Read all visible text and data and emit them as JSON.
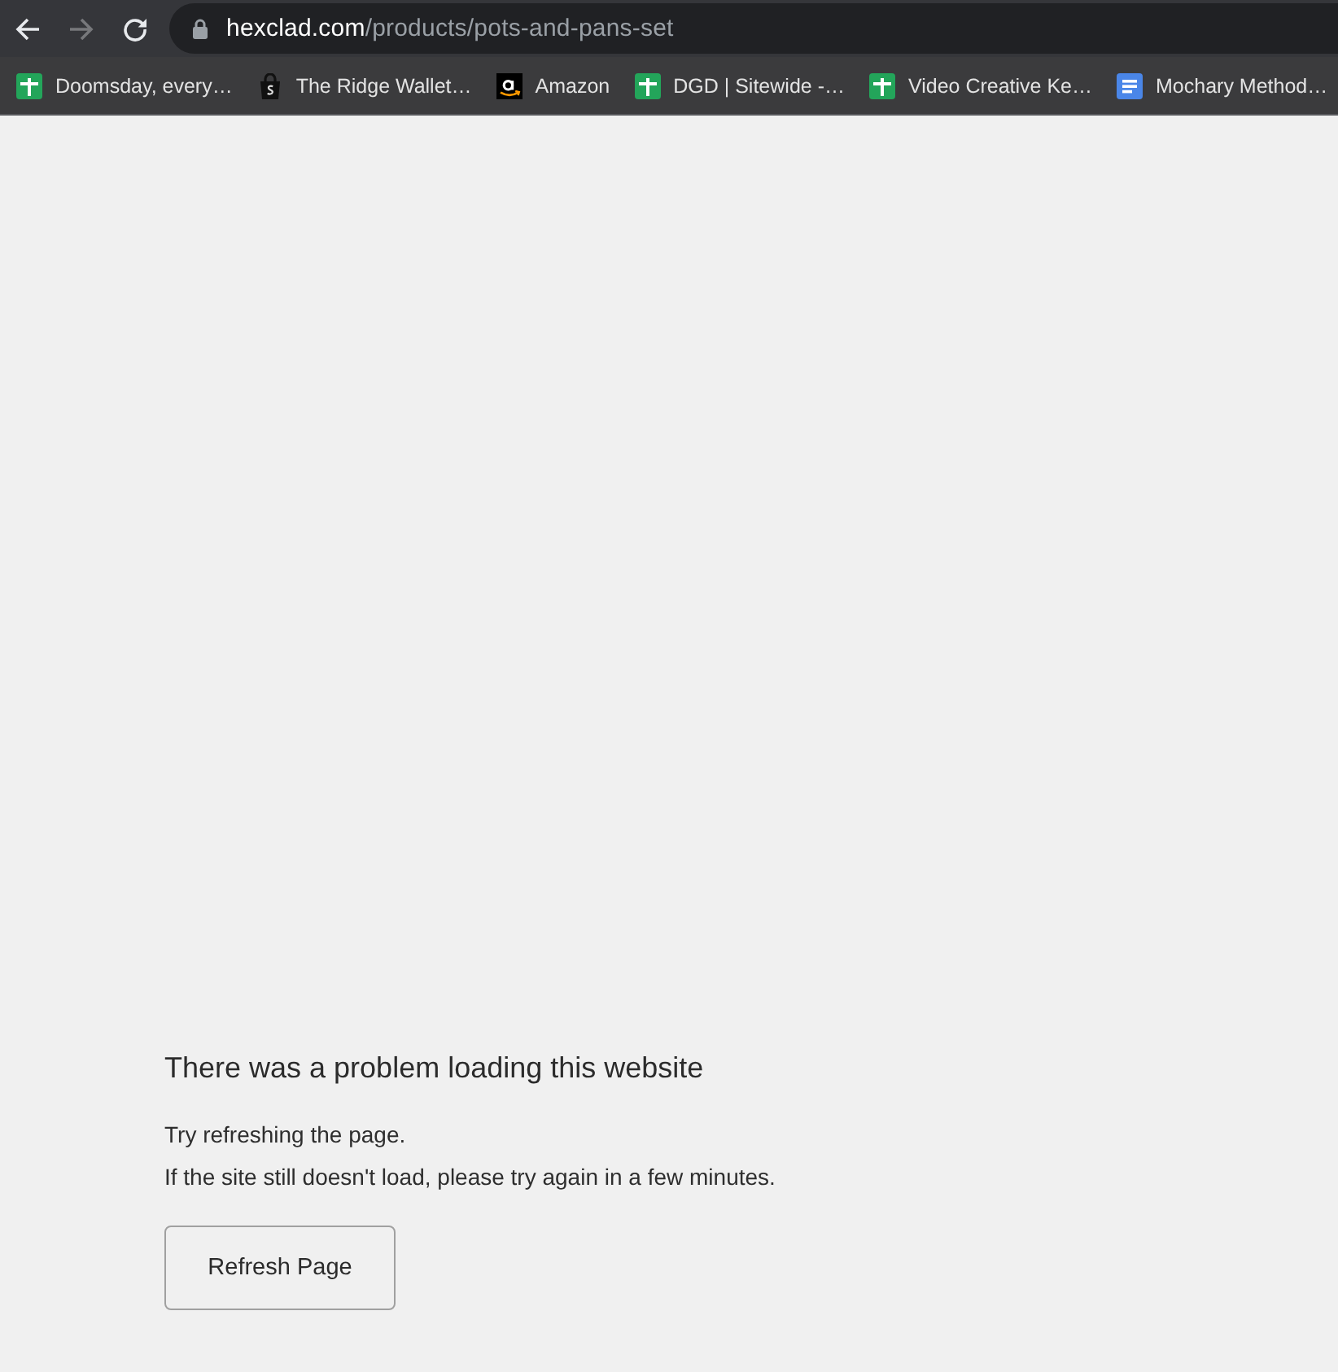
{
  "toolbar": {
    "nav_buttons": [
      {
        "kind": "back",
        "disabled": false
      },
      {
        "kind": "forward",
        "disabled": true
      },
      {
        "kind": "reload",
        "disabled": false
      }
    ],
    "address": {
      "host": "hexclad.com",
      "path": "/products/pots-and-pans-set"
    }
  },
  "bookmarks": [
    {
      "kind": "sheet",
      "label": "Doomsday, every…"
    },
    {
      "kind": "bag",
      "label": "The Ridge Wallet…"
    },
    {
      "kind": "smile",
      "label": "Amazon"
    },
    {
      "kind": "sheet",
      "label": "DGD | Sitewide -…"
    },
    {
      "kind": "sheet",
      "label": "Video Creative Ke…"
    },
    {
      "kind": "doc",
      "label": "Mochary Method…"
    }
  ],
  "error": {
    "title": "There was a problem loading this website",
    "lines": [
      "Try refreshing the page.",
      "If the site still doesn't load, please try again in a few minutes."
    ],
    "button": "Refresh Page"
  }
}
